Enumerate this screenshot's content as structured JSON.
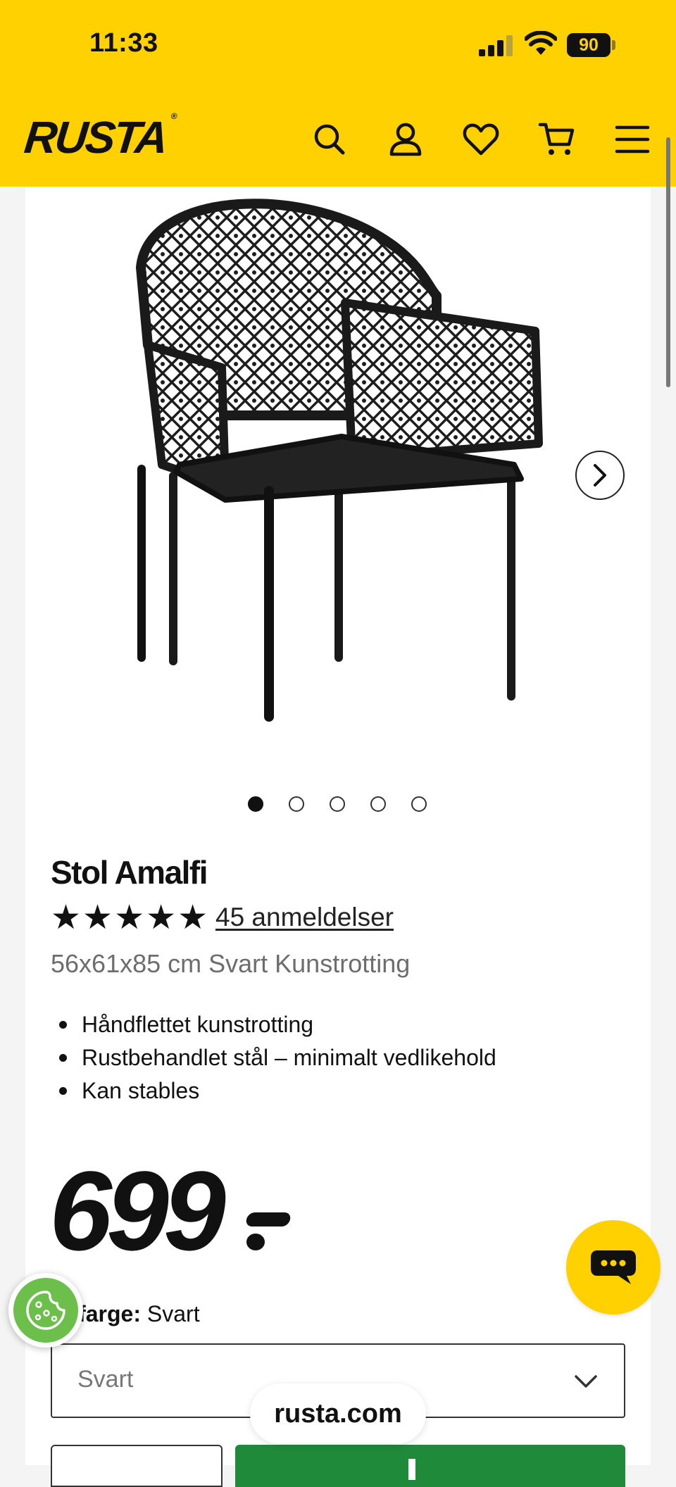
{
  "status_bar": {
    "time": "11:33",
    "battery": "90"
  },
  "header": {
    "logo": "RUSTA",
    "icons": [
      "search-icon",
      "account-icon",
      "wishlist-icon",
      "cart-icon",
      "menu-icon"
    ]
  },
  "gallery": {
    "slide_count": 5,
    "active_slide": 1
  },
  "product": {
    "title": "Stol Amalfi",
    "rating": 5,
    "reviews_label": "45 anmeldelser",
    "subtitle": "56x61x85 cm Svart Kunstrotting",
    "bullets": [
      "Håndflettet kunstrotting",
      "Rustbehandlet stål – minimalt vedlikehold",
      "Kan stables"
    ],
    "price": "699"
  },
  "color": {
    "label_visible": "gt farge:",
    "selected": "Svart",
    "select_value": "Svart"
  },
  "browser": {
    "url": "rusta.com"
  },
  "colors": {
    "brand_yellow": "#ffd100",
    "buy_green": "#1f8a3a",
    "cookie_green": "#6cbf4b"
  }
}
